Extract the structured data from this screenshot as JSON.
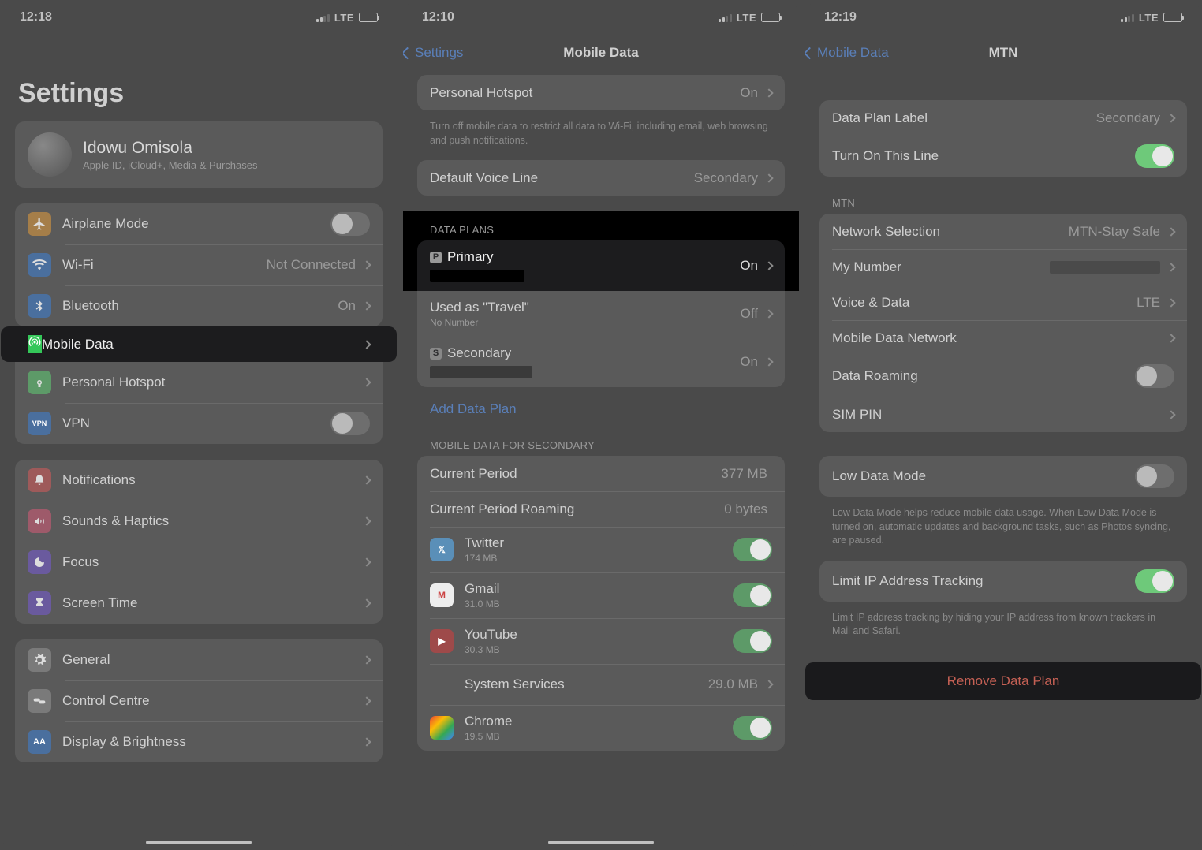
{
  "screen1": {
    "time": "12:18",
    "network": "LTE",
    "title": "Settings",
    "profile": {
      "name": "Idowu Omisola",
      "subtitle": "Apple ID, iCloud+, Media & Purchases"
    },
    "rows": {
      "airplane": {
        "label": "Airplane Mode"
      },
      "wifi": {
        "label": "Wi-Fi",
        "value": "Not Connected"
      },
      "bluetooth": {
        "label": "Bluetooth",
        "value": "On"
      },
      "mobiledata": {
        "label": "Mobile Data"
      },
      "hotspot": {
        "label": "Personal Hotspot"
      },
      "vpn": {
        "label": "VPN",
        "badge": "VPN"
      },
      "notifications": {
        "label": "Notifications"
      },
      "sounds": {
        "label": "Sounds & Haptics"
      },
      "focus": {
        "label": "Focus"
      },
      "screentime": {
        "label": "Screen Time"
      },
      "general": {
        "label": "General"
      },
      "control": {
        "label": "Control Centre"
      },
      "display": {
        "label": "Display & Brightness"
      }
    }
  },
  "screen2": {
    "time": "12:10",
    "network": "LTE",
    "back": "Settings",
    "title": "Mobile Data",
    "hotspot": {
      "label": "Personal Hotspot",
      "value": "On"
    },
    "hotspot_footer": "Turn off mobile data to restrict all data to Wi-Fi, including email, web browsing and push notifications.",
    "voice": {
      "label": "Default Voice Line",
      "value": "Secondary"
    },
    "dataplans_header": "DATA PLANS",
    "primary": {
      "badge": "P",
      "label": "Primary",
      "value": "On"
    },
    "travel": {
      "label": "Used as \"Travel\"",
      "sub": "No Number",
      "value": "Off"
    },
    "secondary": {
      "badge": "S",
      "label": "Secondary",
      "value": "On"
    },
    "add": "Add Data Plan",
    "usage_header": "MOBILE DATA FOR SECONDARY",
    "current": {
      "label": "Current Period",
      "value": "377 MB"
    },
    "roaming": {
      "label": "Current Period Roaming",
      "value": "0 bytes"
    },
    "apps": [
      {
        "name": "Twitter",
        "size": "174 MB",
        "color": "#5a8fb8"
      },
      {
        "name": "Gmail",
        "size": "31.0 MB",
        "color": "#d0d0d0"
      },
      {
        "name": "YouTube",
        "size": "30.3 MB",
        "color": "#9e4a4a"
      },
      {
        "name": "System Services",
        "size": "29.0 MB"
      },
      {
        "name": "Chrome",
        "size": "19.5 MB",
        "color": "#d0d0d0"
      }
    ]
  },
  "screen3": {
    "time": "12:19",
    "network": "LTE",
    "back": "Mobile Data",
    "title": "MTN",
    "label": {
      "label": "Data Plan Label",
      "value": "Secondary"
    },
    "turnon": {
      "label": "Turn On This Line"
    },
    "carrier_header": "MTN",
    "network_sel": {
      "label": "Network Selection",
      "value": "MTN-Stay Safe"
    },
    "mynumber": {
      "label": "My Number"
    },
    "voicedata": {
      "label": "Voice & Data",
      "value": "LTE"
    },
    "mdn": {
      "label": "Mobile Data Network"
    },
    "dataroam": {
      "label": "Data Roaming"
    },
    "simpin": {
      "label": "SIM PIN"
    },
    "lowdata": {
      "label": "Low Data Mode"
    },
    "lowdata_footer": "Low Data Mode helps reduce mobile data usage. When Low Data Mode is turned on, automatic updates and background tasks, such as Photos syncing, are paused.",
    "limitip": {
      "label": "Limit IP Address Tracking"
    },
    "limitip_footer": "Limit IP address tracking by hiding your IP address from known trackers in Mail and Safari.",
    "remove": "Remove Data Plan"
  }
}
